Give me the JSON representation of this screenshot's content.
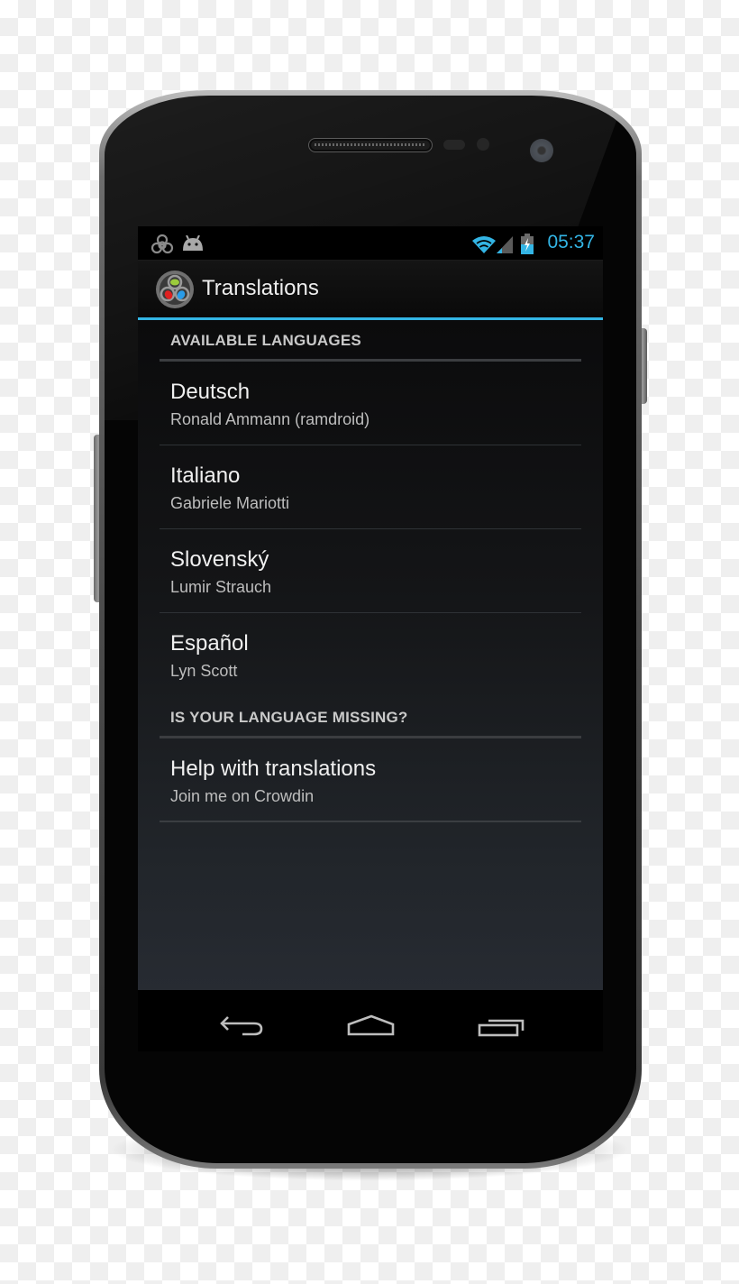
{
  "status_bar": {
    "time": "05:37",
    "notification_icons": [
      "biohazard-icon",
      "android-icon"
    ],
    "system_icons": [
      "wifi-icon",
      "cell-signal-icon",
      "battery-charging-icon"
    ],
    "accent_color": "#33b5e5"
  },
  "action_bar": {
    "title": "Translations",
    "logo_icon": "app-biohazard-logo-icon"
  },
  "sections": [
    {
      "header": "AVAILABLE LANGUAGES",
      "items": [
        {
          "title": "Deutsch",
          "subtitle": "Ronald Ammann (ramdroid)"
        },
        {
          "title": "Italiano",
          "subtitle": "Gabriele Mariotti"
        },
        {
          "title": "Slovenský",
          "subtitle": "Lumir Strauch"
        },
        {
          "title": "Español",
          "subtitle": "Lyn Scott"
        }
      ]
    },
    {
      "header": "IS YOUR LANGUAGE MISSING?",
      "items": [
        {
          "title": "Help with translations",
          "subtitle": "Join me on Crowdin"
        }
      ]
    }
  ],
  "nav_bar": {
    "buttons": [
      "back-icon",
      "home-icon",
      "recent-apps-icon"
    ]
  }
}
